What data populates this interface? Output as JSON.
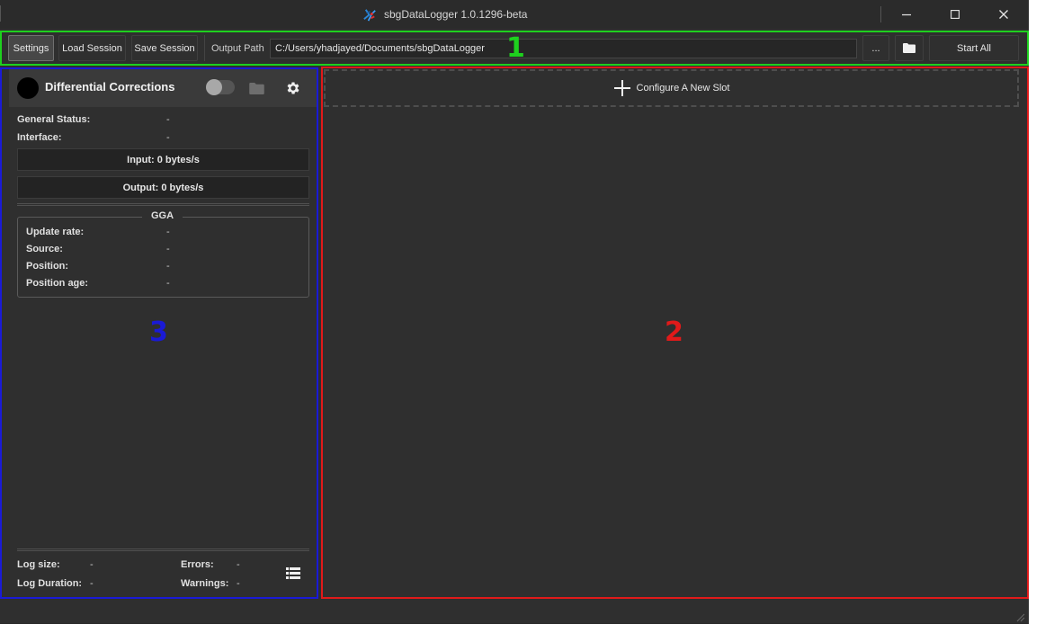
{
  "window": {
    "title": "sbgDataLogger 1.0.1296-beta"
  },
  "toolbar": {
    "settings_label": "Settings",
    "load_session_label": "Load Session",
    "save_session_label": "Save Session",
    "output_path_label": "Output Path",
    "output_path_value": "C:/Users/yhadjayed/Documents/sbgDataLogger",
    "browse_label": "...",
    "start_all_label": "Start All"
  },
  "annotations": {
    "toolbar_number": "1",
    "slots_number": "2",
    "panel_number": "3",
    "toolbar_color": "#1ed01e",
    "slots_color": "#e01a1a",
    "panel_color": "#1a1ad6"
  },
  "panel": {
    "title": "Differential Corrections",
    "status_color": "#000000",
    "toggle_on": false,
    "general_status_label": "General Status:",
    "general_status_value": "-",
    "interface_label": "Interface:",
    "interface_value": "-",
    "input_rate": "Input: 0 bytes/s",
    "output_rate": "Output: 0 bytes/s",
    "gga": {
      "title": "GGA",
      "update_rate_label": "Update rate:",
      "update_rate_value": "-",
      "source_label": "Source:",
      "source_value": "-",
      "position_label": "Position:",
      "position_value": "-",
      "position_age_label": "Position age:",
      "position_age_value": "-"
    },
    "footer": {
      "log_size_label": "Log size:",
      "log_size_value": "-",
      "log_duration_label": "Log Duration:",
      "log_duration_value": "-",
      "errors_label": "Errors:",
      "errors_value": "-",
      "warnings_label": "Warnings:",
      "warnings_value": "-"
    }
  },
  "slots": {
    "configure_label": "Configure A New Slot"
  },
  "icons": {
    "logo": "sbg-logo-icon",
    "minimize": "minimize-icon",
    "maximize": "maximize-icon",
    "close": "close-icon",
    "folder": "folder-icon",
    "gear": "gear-icon",
    "plus": "plus-icon",
    "list": "list-icon"
  }
}
